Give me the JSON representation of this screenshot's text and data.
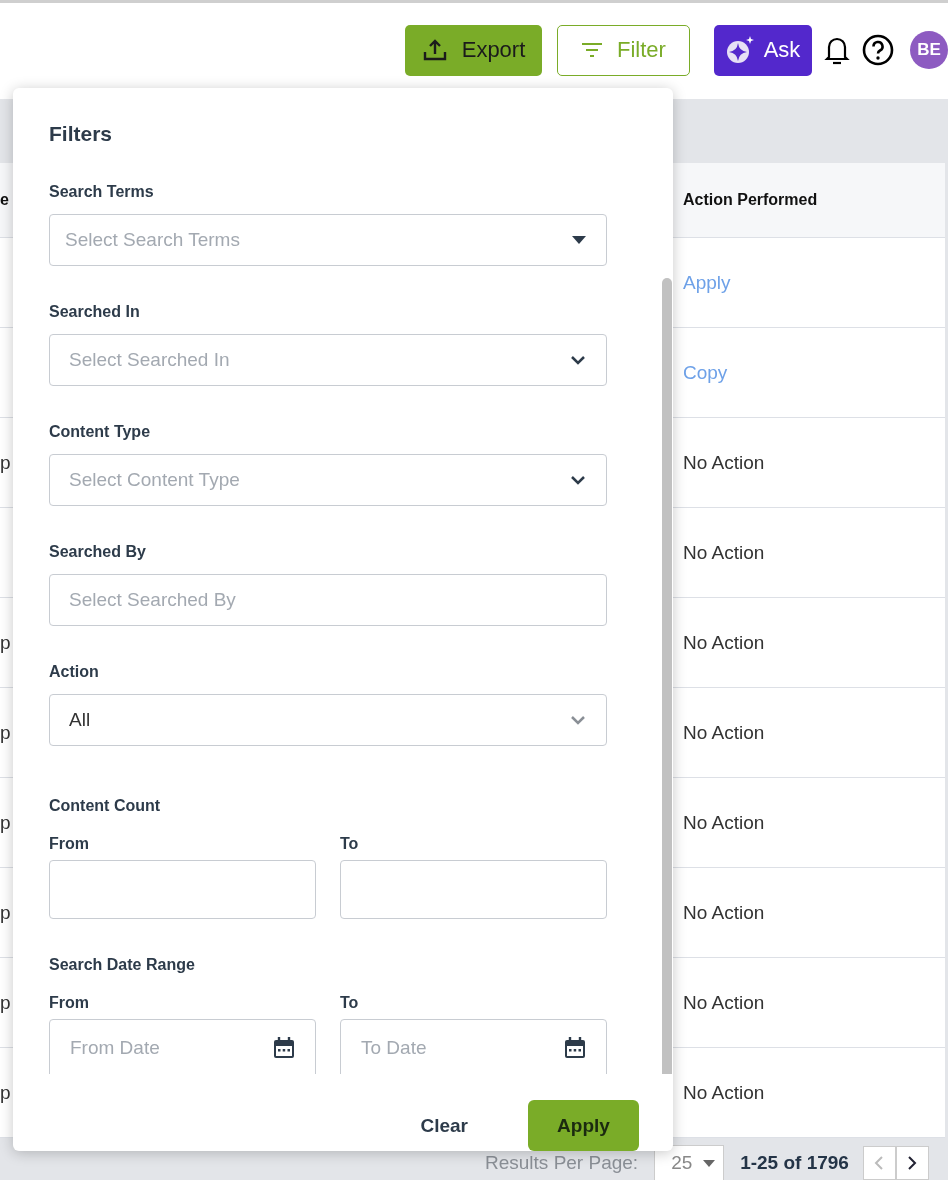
{
  "header": {
    "export_button": "Export",
    "filter_button": "Filter",
    "ask_button": "Ask",
    "avatar": "BE"
  },
  "table": {
    "columns": [
      {
        "label": "e"
      },
      {
        "label": "Action Performed"
      }
    ],
    "rows": [
      {
        "column_1": "",
        "action": "Apply",
        "kind": "link"
      },
      {
        "column_1": "",
        "action": "Copy",
        "kind": "link"
      },
      {
        "column_1": "p",
        "action": "No Action",
        "kind": "text"
      },
      {
        "column_1": "",
        "action": "No Action",
        "kind": "text"
      },
      {
        "column_1": "p",
        "action": "No Action",
        "kind": "text"
      },
      {
        "column_1": "p",
        "action": "No Action",
        "kind": "text"
      },
      {
        "column_1": "p",
        "action": "No Action",
        "kind": "text"
      },
      {
        "column_1": "p",
        "action": "No Action",
        "kind": "text"
      },
      {
        "column_1": "p",
        "action": "No Action",
        "kind": "text"
      },
      {
        "column_1": "p",
        "action": "No Action",
        "kind": "text"
      }
    ]
  },
  "pagination": {
    "per_page_label": "Results Per Page:",
    "per_page": "25",
    "range": "1-25 of 1796"
  },
  "filters": {
    "title": "Filters",
    "sections": [
      {
        "kind": "dropdown",
        "label": "Search Terms",
        "placeholder": "Select Search Terms"
      },
      {
        "kind": "combo",
        "label": "Searched In",
        "placeholder": "Select Searched In"
      },
      {
        "kind": "combo",
        "label": "Content Type",
        "placeholder": "Select Content Type"
      },
      {
        "kind": "text",
        "label": "Searched By",
        "placeholder": "Select Searched By"
      },
      {
        "kind": "select",
        "label": "Action",
        "value": "All"
      },
      {
        "kind": "number_range",
        "label": "Content Count",
        "from_label": "From",
        "to_label": "To"
      },
      {
        "kind": "date_range",
        "label": "Search Date Range",
        "from_label": "From",
        "to_label": "To",
        "from_placeholder": "From Date",
        "to_placeholder": "To Date"
      }
    ],
    "clear_button": "Clear",
    "apply_button": "Apply"
  }
}
